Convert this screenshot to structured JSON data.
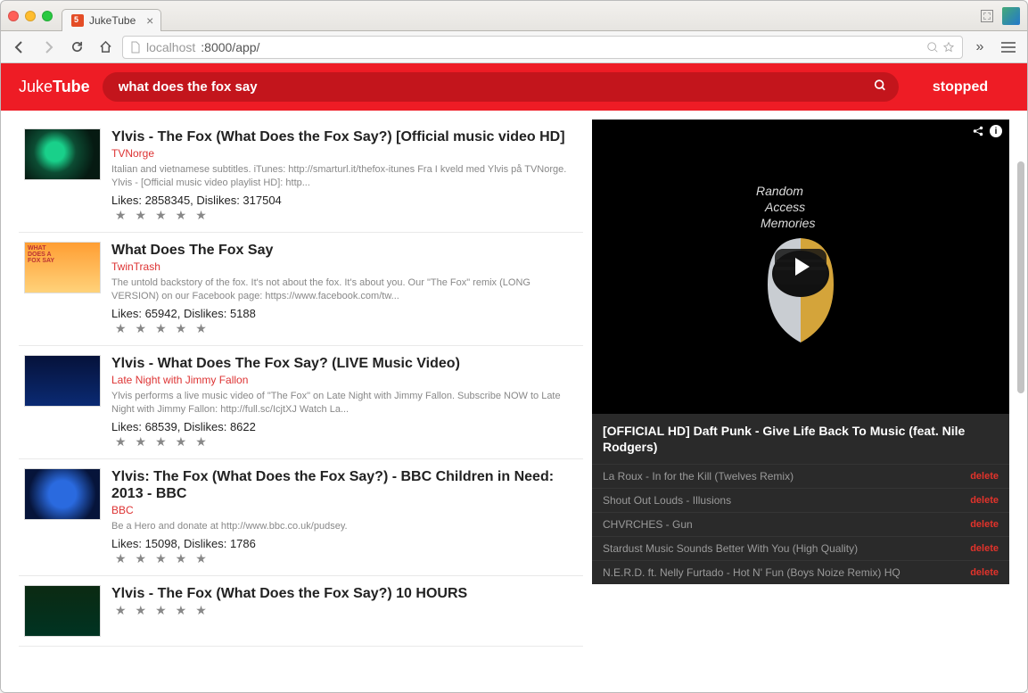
{
  "browser": {
    "tab_title": "JukeTube",
    "url_protocol": "localhost",
    "url_path": ":8000/app/"
  },
  "app": {
    "logo_pre": "Juke",
    "logo_bold": "Tube",
    "search_value": "what does the fox say",
    "status": "stopped"
  },
  "results": [
    {
      "title": "Ylvis - The Fox (What Does the Fox Say?) [Official music video HD]",
      "author": "TVNorge",
      "desc": "Italian and vietnamese subtitles. iTunes: http://smarturl.it/thefox-itunes Fra I kveld med Ylvis på TVNorge. Ylvis - [Official music video playlist HD]: http...",
      "likes": "Likes: 2858345, Dislikes: 317504",
      "thumb": "th0"
    },
    {
      "title": "What Does The Fox Say",
      "author": "TwinTrash",
      "desc": "The untold backstory of the fox. It's not about the fox. It's about you. Our \"The Fox\" remix (LONG VERSION) on our Facebook page: https://www.facebook.com/tw...",
      "likes": "Likes: 65942, Dislikes: 5188",
      "thumb": "th1"
    },
    {
      "title": "Ylvis - What Does The Fox Say? (LIVE Music Video)",
      "author": "Late Night with Jimmy Fallon",
      "desc": "Ylvis performs a live music video of \"The Fox\" on Late Night with Jimmy Fallon. Subscribe NOW to Late Night with Jimmy Fallon: http://full.sc/IcjtXJ Watch La...",
      "likes": "Likes: 68539, Dislikes: 8622",
      "thumb": "th2"
    },
    {
      "title": "Ylvis: The Fox (What Does the Fox Say?) - BBC Children in Need: 2013 - BBC",
      "author": "BBC",
      "desc": "Be a Hero and donate at http://www.bbc.co.uk/pudsey.",
      "likes": "Likes: 15098, Dislikes: 1786",
      "thumb": "th3"
    },
    {
      "title": "Ylvis - The Fox (What Does the Fox Say?) 10 HOURS",
      "author": "",
      "desc": "",
      "likes": "",
      "thumb": "th4"
    }
  ],
  "player": {
    "now_playing": "[OFFICIAL HD] Daft Punk - Give Life Back To Music (feat. Nile Rodgers)"
  },
  "playlist": [
    {
      "title": "La Roux - In for the Kill (Twelves Remix)",
      "action": "delete"
    },
    {
      "title": "Shout Out Louds - Illusions",
      "action": "delete"
    },
    {
      "title": "CHVRCHES - Gun",
      "action": "delete"
    },
    {
      "title": "Stardust Music Sounds Better With You (High Quality)",
      "action": "delete"
    },
    {
      "title": "N.E.R.D. ft. Nelly Furtado - Hot N' Fun (Boys Noize Remix) HQ",
      "action": "delete"
    }
  ]
}
